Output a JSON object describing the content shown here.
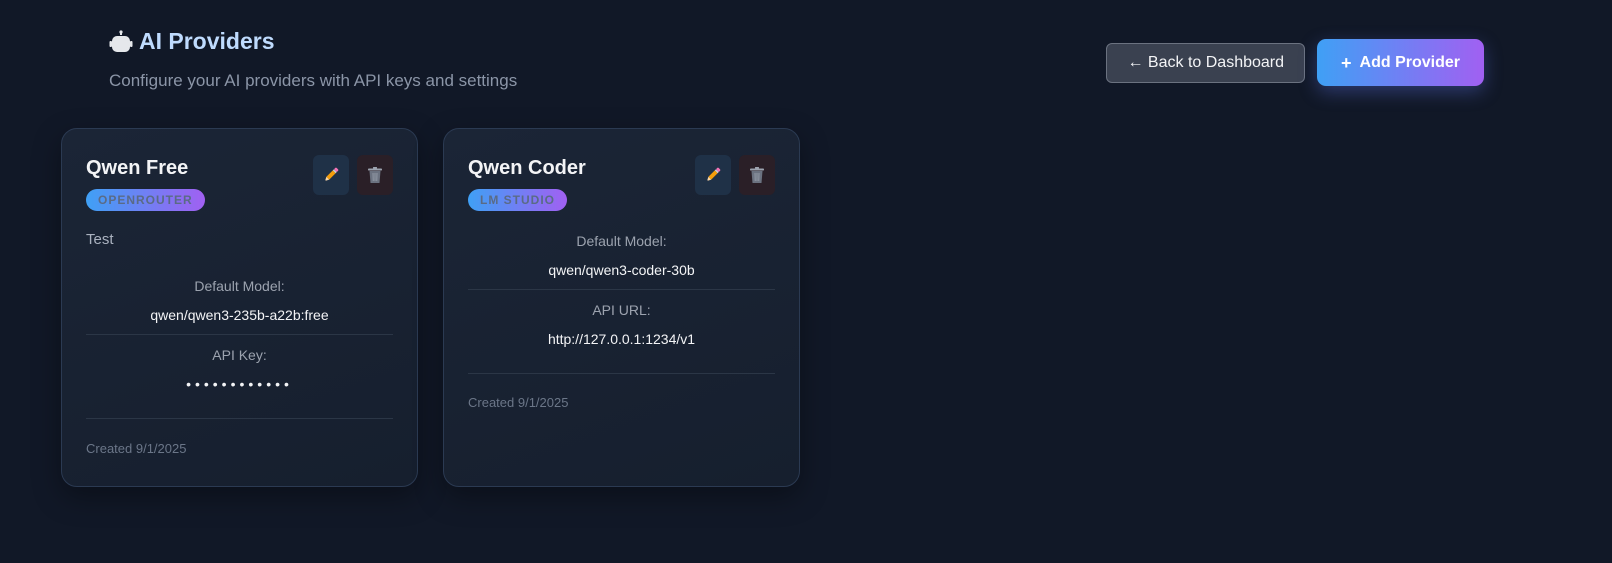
{
  "header": {
    "title": "AI Providers",
    "title_icon": "robot-icon",
    "subtitle": "Configure your AI providers with API keys and settings"
  },
  "actions": {
    "back_label": "← Back to Dashboard",
    "add_icon": "+",
    "add_label": "Add Provider"
  },
  "colors": {
    "background": "#111827",
    "accent_start": "#3fa0f5",
    "accent_end": "#a160f2"
  },
  "providers": [
    {
      "name": "Qwen Free",
      "type": "OPENROUTER",
      "description": "Test",
      "fields": [
        {
          "label": "Default Model:",
          "value": "qwen/qwen3-235b-a22b:free"
        },
        {
          "label": "API Key:",
          "value": "••••••••••••"
        }
      ],
      "created": "Created 9/1/2025"
    },
    {
      "name": "Qwen Coder",
      "type": "LM STUDIO",
      "fields": [
        {
          "label": "Default Model:",
          "value": "qwen/qwen3-coder-30b"
        },
        {
          "label": "API URL:",
          "value": "http://127.0.0.1:1234/v1"
        }
      ],
      "created": "Created 9/1/2025"
    }
  ]
}
